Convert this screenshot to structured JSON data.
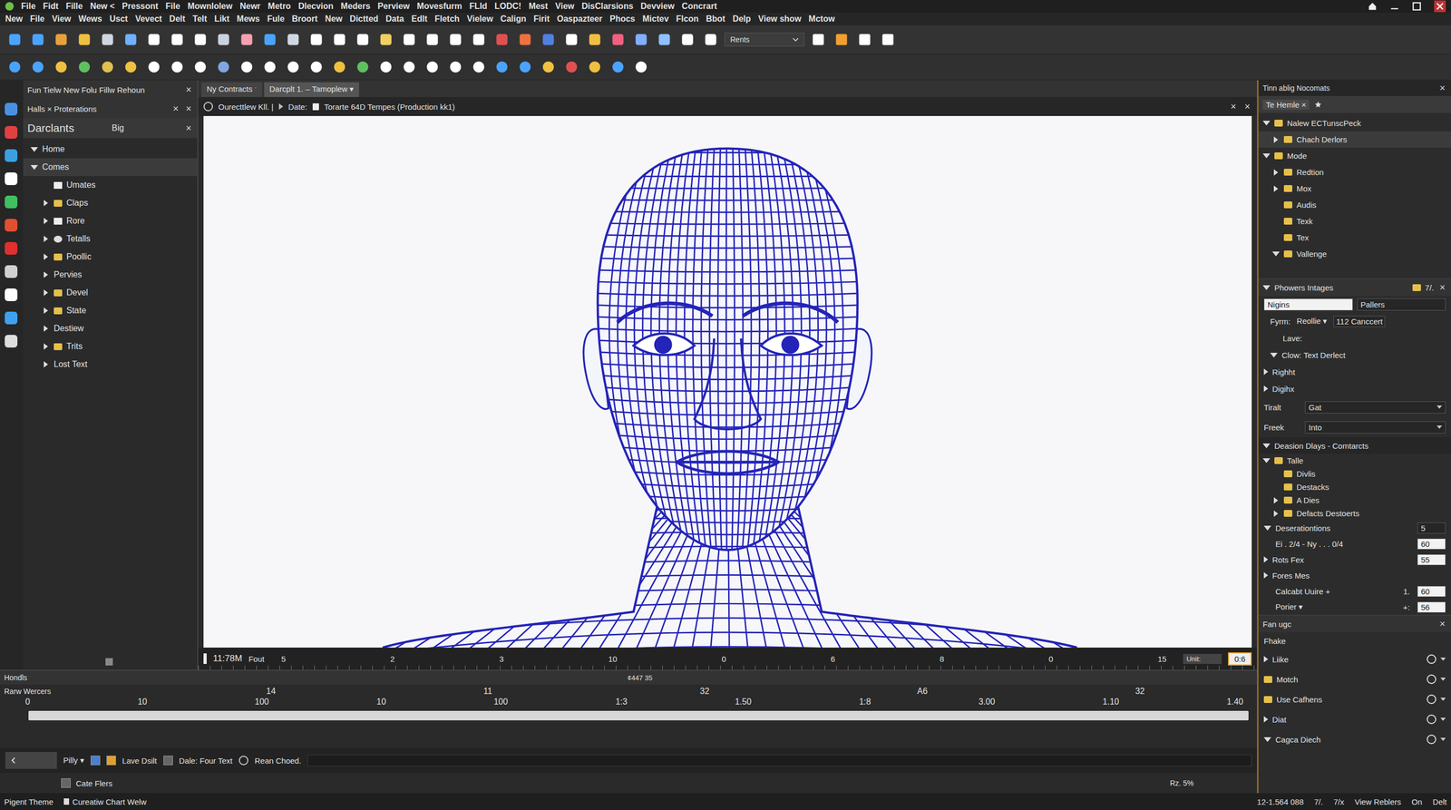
{
  "window": {
    "title_menu": [
      "File",
      "Fidt",
      "Fille",
      "New <",
      "Pressont",
      "File",
      "Mownlolew",
      "Newr",
      "Metro",
      "Dlecvion",
      "Meders",
      "Perview",
      "Movesfurm",
      "FLId",
      "LODC!",
      "Mest",
      "View",
      "DisClarsions",
      "Devview",
      "Concrart"
    ],
    "menu": [
      "New",
      "File",
      "View",
      "Wews",
      "Usct",
      "Vevect",
      "Delt",
      "Telt",
      "Likt",
      "Mews",
      "Fule",
      "Broort",
      "New",
      "Dictted",
      "Data",
      "Edlt",
      "Fletch",
      "Vielew",
      "Calign",
      "Firit",
      "Oaspazteer",
      "Phocs",
      "Mictev",
      "Flcon",
      "Bbot",
      "Delp",
      "View show",
      "Mctow"
    ]
  },
  "toolbar": {
    "dropdown": "Rents"
  },
  "left_panel": {
    "tab_row": {
      "label": "Fun Tielw New Folu Fillw Rehoun",
      "close": "×"
    },
    "tab_row2": {
      "label": "Halls × Proterations",
      "closes": [
        "×",
        "×"
      ]
    },
    "title": "Darclants",
    "mode": "Big",
    "close": "×",
    "tree": [
      {
        "label": "Home",
        "depth": 0,
        "branch": true,
        "expanded": true,
        "kind": "none"
      },
      {
        "label": "Comes",
        "depth": 0,
        "branch": true,
        "expanded": true,
        "kind": "none"
      },
      {
        "label": "Umates",
        "depth": 1,
        "branch": false,
        "expanded": false,
        "kind": "file"
      },
      {
        "label": "Claps",
        "depth": 1,
        "branch": true,
        "expanded": false,
        "kind": "folder"
      },
      {
        "label": "Rore",
        "depth": 1,
        "branch": true,
        "expanded": false,
        "kind": "file"
      },
      {
        "label": "Tetalls",
        "depth": 1,
        "branch": true,
        "expanded": false,
        "kind": "gear"
      },
      {
        "label": "Poollic",
        "depth": 1,
        "branch": true,
        "expanded": false,
        "kind": "folder"
      },
      {
        "label": "Pervies",
        "depth": 1,
        "branch": true,
        "expanded": false,
        "kind": "none"
      },
      {
        "label": "Devel",
        "depth": 1,
        "branch": true,
        "expanded": false,
        "kind": "folder"
      },
      {
        "label": "State",
        "depth": 1,
        "branch": true,
        "expanded": false,
        "kind": "folder"
      },
      {
        "label": "Destiew",
        "depth": 1,
        "branch": true,
        "expanded": false,
        "kind": "none"
      },
      {
        "label": "Trits",
        "depth": 1,
        "branch": true,
        "expanded": false,
        "kind": "folder"
      },
      {
        "label": "Lost Text",
        "depth": 1,
        "branch": true,
        "expanded": false,
        "kind": "none"
      }
    ]
  },
  "viewport": {
    "tabs": [
      {
        "label": "Ny Contracts ˑ",
        "selected": false
      },
      {
        "label": "Darcplt 1. – Tamoplew ▾",
        "selected": true
      }
    ],
    "path": [
      "Ourecttlew Kll. |",
      "Date:",
      "Torarte 64D Tempes (Production kk1)"
    ],
    "closes": [
      "×",
      "×"
    ],
    "ruler_time": "11:78M",
    "ruler_unit_label": "Fout",
    "ruler_ticks": [
      "5",
      "2",
      "3",
      "10",
      "0",
      "6",
      "8",
      "0",
      "15"
    ],
    "unit_label": "Unit:",
    "unit_value": "0:6"
  },
  "timeline": {
    "title": "Hondls",
    "center": "¢447 35",
    "track": "Rarw Wercers",
    "top_labels": [
      "14",
      "11",
      "32",
      "A6",
      "32"
    ],
    "bottom_labels": [
      "0",
      "10",
      "100",
      "10",
      "100",
      "1:3",
      "1.50",
      "1:8",
      "3.00",
      "1.10",
      "1.40"
    ],
    "controls": [
      "Pilly ▾",
      "Lave Dsilt",
      "Dale: Four Text",
      "Rean Choed."
    ],
    "sub": "Cate Flers",
    "zoom": "Rz. 5%"
  },
  "right_panel": {
    "header": {
      "title": "Tinn ablig Nocomats",
      "close": "×"
    },
    "tab": "Te Hemle ×",
    "tree": [
      {
        "label": "Nalew ECTunscPeck",
        "depth": 0,
        "branch": true,
        "expanded": true
      },
      {
        "label": "Chach Derlors",
        "depth": 1,
        "branch": true,
        "expanded": false
      },
      {
        "label": "Mode",
        "depth": 0,
        "branch": true,
        "expanded": true
      },
      {
        "label": "Redtion",
        "depth": 1,
        "branch": true,
        "expanded": false
      },
      {
        "label": "Mox",
        "depth": 1,
        "branch": true,
        "expanded": false
      },
      {
        "label": "Audis",
        "depth": 1,
        "branch": false,
        "expanded": false
      },
      {
        "label": "Texk",
        "depth": 1,
        "branch": false,
        "expanded": false
      },
      {
        "label": "Tex",
        "depth": 1,
        "branch": false,
        "expanded": false
      },
      {
        "label": "Vallenge",
        "depth": 1,
        "branch": true,
        "expanded": true
      }
    ],
    "props": {
      "title": "Phowers Intages",
      "badge": "7/.",
      "close": "×",
      "preset": "Nigins",
      "preset_field": "Pallers",
      "form_label": "Fyrm:",
      "form_value": "Reollie ▾",
      "form_value2": "112 Canccert",
      "lave": "Lave:",
      "groups": [
        {
          "label": "Clow: Text Derlect",
          "expanded": true
        },
        {
          "label": "Righht",
          "expanded": false
        },
        {
          "label": "Digihx",
          "expanded": false
        }
      ],
      "fields": [
        {
          "label": "Tiralt",
          "value": "Gat"
        },
        {
          "label": "Freek",
          "value": "Into"
        }
      ]
    },
    "tree2": {
      "title": "Deasion Dlays - Comtarcts",
      "items": [
        {
          "label": "Talle",
          "depth": 0,
          "branch": true,
          "expanded": true
        },
        {
          "label": "Divlis",
          "depth": 1,
          "branch": false,
          "expanded": false
        },
        {
          "label": "Destacks",
          "depth": 1,
          "branch": false,
          "expanded": false
        },
        {
          "label": "A Dies",
          "depth": 1,
          "branch": true,
          "expanded": false
        },
        {
          "label": "Defacts Destoerts",
          "depth": 1,
          "branch": true,
          "expanded": false
        }
      ]
    },
    "params": [
      {
        "label": "Deserationtions",
        "mid": "",
        "value": "5",
        "kind": "header"
      },
      {
        "label": "Ei . 2/4 - Ny . . . 0/4",
        "mid": "",
        "value": "60",
        "kind": "row"
      },
      {
        "label": "Rots Fex",
        "mid": "",
        "value": "55",
        "kind": "expander"
      },
      {
        "label": "Fores Mes",
        "mid": "",
        "value": "",
        "kind": "expander"
      },
      {
        "label": "Calcabt Uuire +",
        "mid": "1.",
        "value": "60",
        "kind": "row"
      },
      {
        "label": "Porier ▾",
        "mid": "+:",
        "value": "56",
        "kind": "row"
      }
    ],
    "bottom": {
      "title": "Fan ugc",
      "close": "×",
      "sub": "Fhake",
      "items": [
        {
          "label": "Liike",
          "kind": "branch",
          "expanded": false
        },
        {
          "label": "Motch",
          "kind": "folder",
          "expanded": false
        },
        {
          "label": "Use Cafhens",
          "kind": "folder",
          "expanded": false
        },
        {
          "label": "Diat",
          "kind": "branch",
          "expanded": false
        },
        {
          "label": "Cagca Diech",
          "kind": "branch",
          "expanded": true
        }
      ]
    }
  },
  "status_bar": {
    "left": [
      "Pigent Theme",
      "Cureatiw Chart Welw"
    ],
    "right": [
      "12-1.564 088",
      "7/.",
      "7/x",
      "View Reblers",
      "On",
      "Delt"
    ]
  }
}
